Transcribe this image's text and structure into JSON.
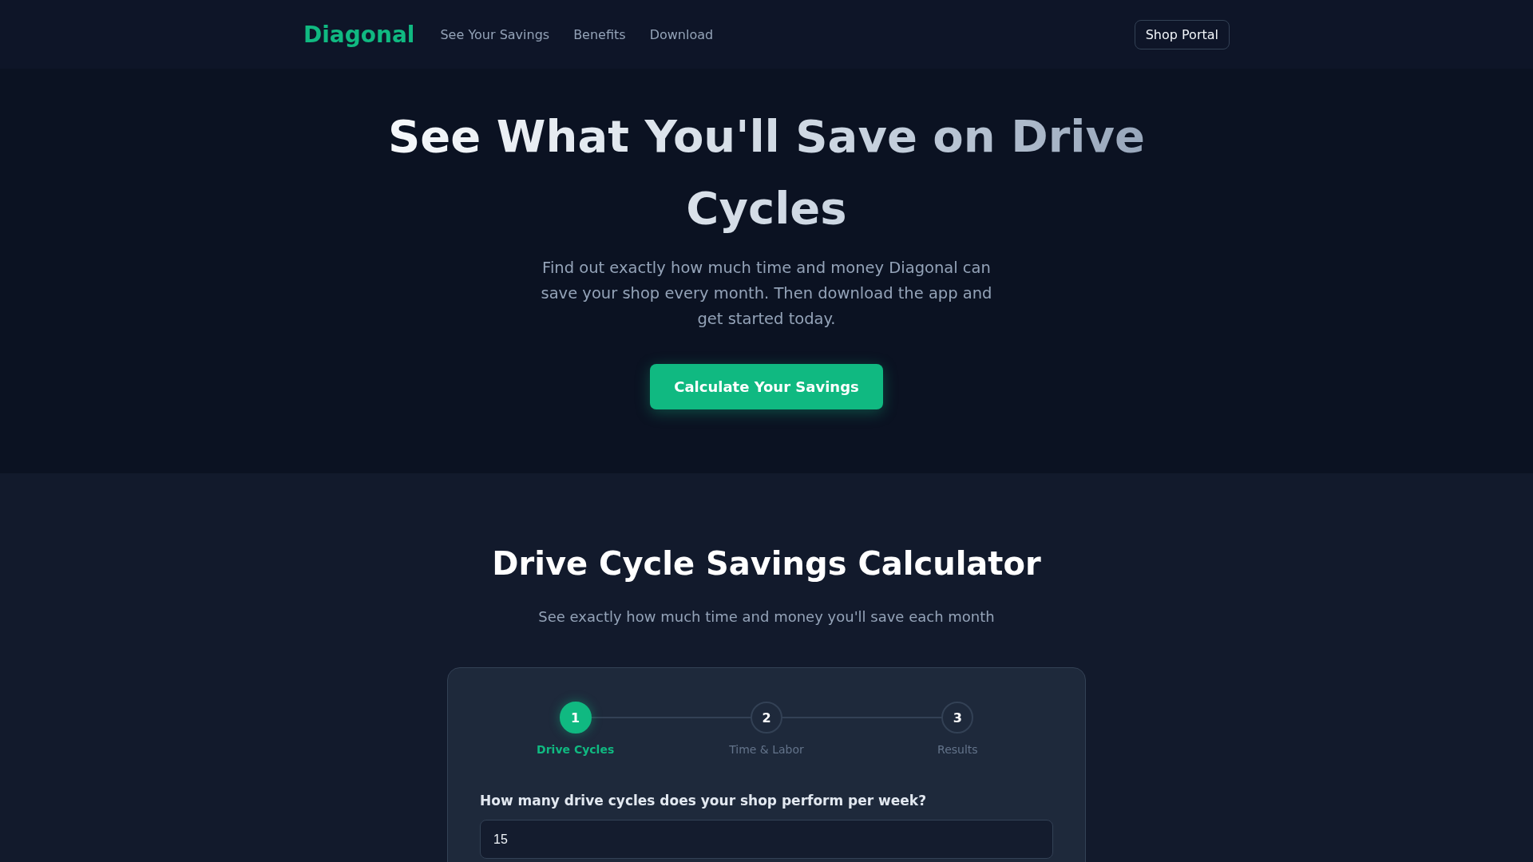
{
  "nav": {
    "logo": "Diagonal",
    "links": [
      "See Your Savings",
      "Benefits",
      "Download"
    ],
    "button": "Shop Portal"
  },
  "hero": {
    "title": "See What You'll Save on Drive Cycles",
    "subtitle": "Find out exactly how much time and money Diagonal can save your shop every month. Then download the app and get started today.",
    "button": "Calculate Your Savings"
  },
  "calculator": {
    "title": "Drive Cycle Savings Calculator",
    "subtitle": "See exactly how much time and money you'll save each month",
    "steps": [
      {
        "number": "1",
        "label": "Drive Cycles",
        "selected": true
      },
      {
        "number": "2",
        "label": "Time & Labor",
        "selected": false
      },
      {
        "number": "3",
        "label": "Results",
        "selected": false
      }
    ],
    "question": "How many drive cycles does your shop perform per week?",
    "input": {
      "value": "15"
    }
  }
}
